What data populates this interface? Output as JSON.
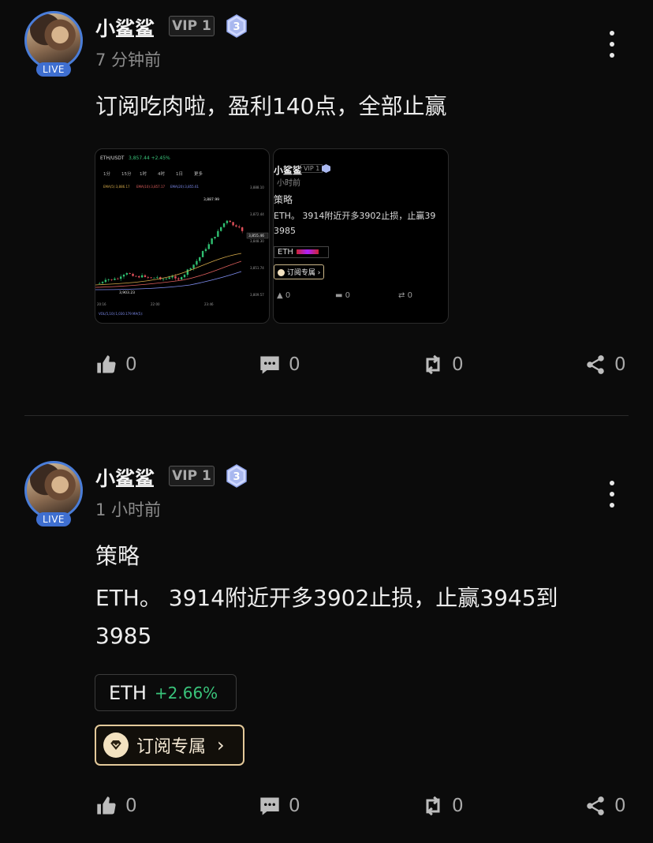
{
  "posts": [
    {
      "author": "小鲨鲨",
      "vip": "VIP 1",
      "level": "3",
      "live": "LIVE",
      "time": "7 分钟前",
      "text": "订阅吃肉啦，盈利140点，全部止赢",
      "thumb_chart": {
        "pair": "ETH/USDT",
        "price_line": "3,857.44 +2.45%",
        "intervals": [
          "1分",
          "15分",
          "1时",
          "4时",
          "1日",
          "更多"
        ],
        "high_label": "3,887.99",
        "low_label": "3,903.23",
        "current_label": "3,855.46",
        "right_ticks": [
          "3,888.10",
          "3,872.44",
          "3,848.30",
          "3,851.74",
          "3,809.57"
        ],
        "x_ticks": [
          "20:16",
          "22:00",
          "23:46"
        ]
      },
      "thumb_post": {
        "author": "小鲨鲨",
        "vip": "VIP 1",
        "time": "小时前",
        "line1": "策略",
        "line2": "ETH。 3914附近开多3902止损，止赢39",
        "line3": "3985",
        "tag": "ETH",
        "sub": "订阅专属",
        "counts": [
          "0",
          "0",
          "0"
        ]
      },
      "actions": {
        "like": "0",
        "comment": "0",
        "repost": "0",
        "share": "0"
      }
    },
    {
      "author": "小鲨鲨",
      "vip": "VIP 1",
      "level": "3",
      "live": "LIVE",
      "time": "1 小时前",
      "text_lines": [
        "策略",
        "ETH。 3914附近开多3902止损，止赢3945到",
        "3985"
      ],
      "tag": {
        "symbol": "ETH",
        "change": "+2.66%"
      },
      "subscribe_label": "订阅专属",
      "actions": {
        "like": "0",
        "comment": "0",
        "repost": "0",
        "share": "0"
      }
    }
  ],
  "colors": {
    "background": "#0b0b0b",
    "live_badge": "#3f6fd0",
    "gain": "#39c37a",
    "subscribe_border": "#e3c99a"
  }
}
